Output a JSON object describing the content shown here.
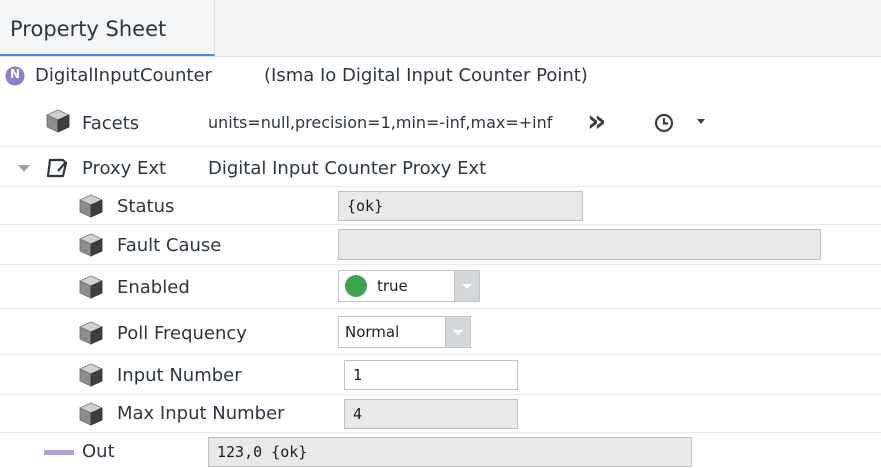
{
  "tab": {
    "label": "Property Sheet"
  },
  "header": {
    "badge": "N",
    "badge_color": "#8a7fc8",
    "name": "DigitalInputCounter",
    "type": "(Isma Io Digital Input Counter Point)"
  },
  "facets": {
    "label": "Facets",
    "value": "units=null,precision=1,min=-inf,max=+inf",
    "expand_glyph": "»"
  },
  "proxy": {
    "label": "Proxy Ext",
    "type": "Digital Input Counter Proxy Ext",
    "properties": {
      "status": {
        "label": "Status",
        "value": "{ok}"
      },
      "fault_cause": {
        "label": "Fault Cause",
        "value": ""
      },
      "enabled": {
        "label": "Enabled",
        "value": "true",
        "indicator_color": "#3da24b"
      },
      "poll_frequency": {
        "label": "Poll Frequency",
        "value": "Normal"
      },
      "input_number": {
        "label": "Input Number",
        "value": "1"
      },
      "max_input_number": {
        "label": "Max Input Number",
        "value": "4"
      }
    }
  },
  "out": {
    "label": "Out",
    "value": "123,0 {ok}",
    "color": "#b79ad6"
  }
}
